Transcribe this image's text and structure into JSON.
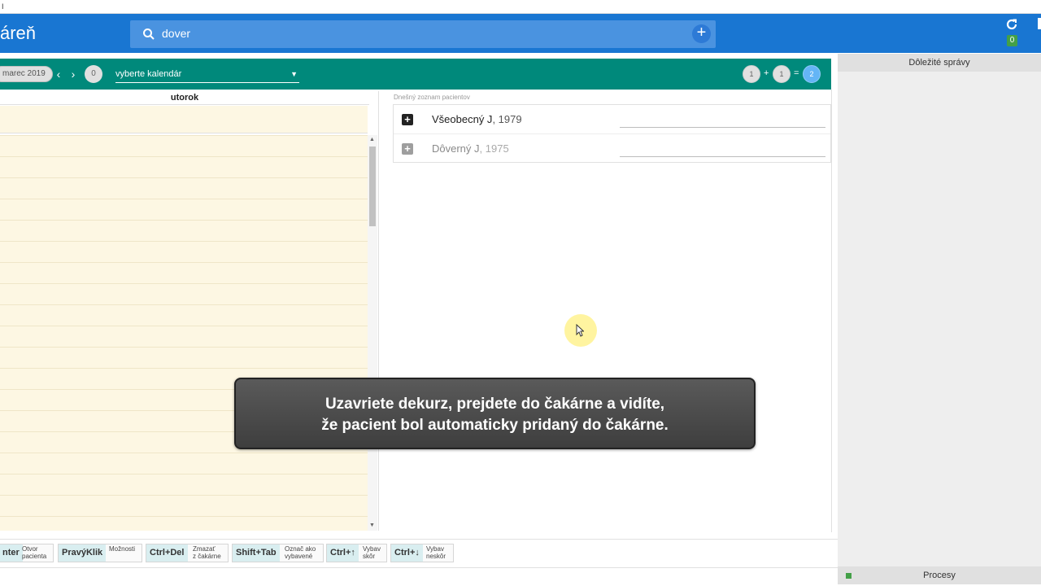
{
  "window": {
    "title": "I"
  },
  "appbar": {
    "title": "áreň",
    "search_value": "dover",
    "notif_count": "0"
  },
  "toolbar": {
    "month": "marec 2019",
    "prev": "‹",
    "next": "›",
    "zero": "0",
    "calendar_select": "vyberte kalendár",
    "count_a": "1",
    "plus": "+",
    "count_b": "1",
    "equals": "=",
    "count_total": "2"
  },
  "calendar": {
    "day_header": "utorok"
  },
  "patients": {
    "label": "Dnešný zoznam pacientov",
    "rows": [
      {
        "name": "Všeobecný J",
        "year": ", 1979"
      },
      {
        "name": "Dôverný J",
        "year": ", 1975"
      }
    ]
  },
  "caption": {
    "line1": "Uzavriete dekurz, prejdete do čakárne a vidíte,",
    "line2": "že pacient bol automaticky pridaný do čakárne."
  },
  "sidepanel": {
    "header": "Dôležité správy",
    "processes": "Procesy"
  },
  "shortcuts": [
    {
      "key": "nter",
      "desc1": "Otvor",
      "desc2": "pacienta"
    },
    {
      "key": "PravýKlik",
      "desc1": "Možnosti",
      "desc2": ""
    },
    {
      "key": "Ctrl+Del",
      "desc1": "Zmazať",
      "desc2": "z čakárne"
    },
    {
      "key": "Shift+Tab",
      "desc1": "Označ ako",
      "desc2": "vybavené"
    },
    {
      "key": "Ctrl+↑",
      "desc1": "Vybav",
      "desc2": "skôr"
    },
    {
      "key": "Ctrl+↓",
      "desc1": "Vybav",
      "desc2": "neskôr"
    }
  ],
  "colors": {
    "appbar": "#1976d2",
    "toolbar": "#00897b",
    "calendar_bg": "#fdf7e3",
    "badge_green": "#43a047"
  }
}
